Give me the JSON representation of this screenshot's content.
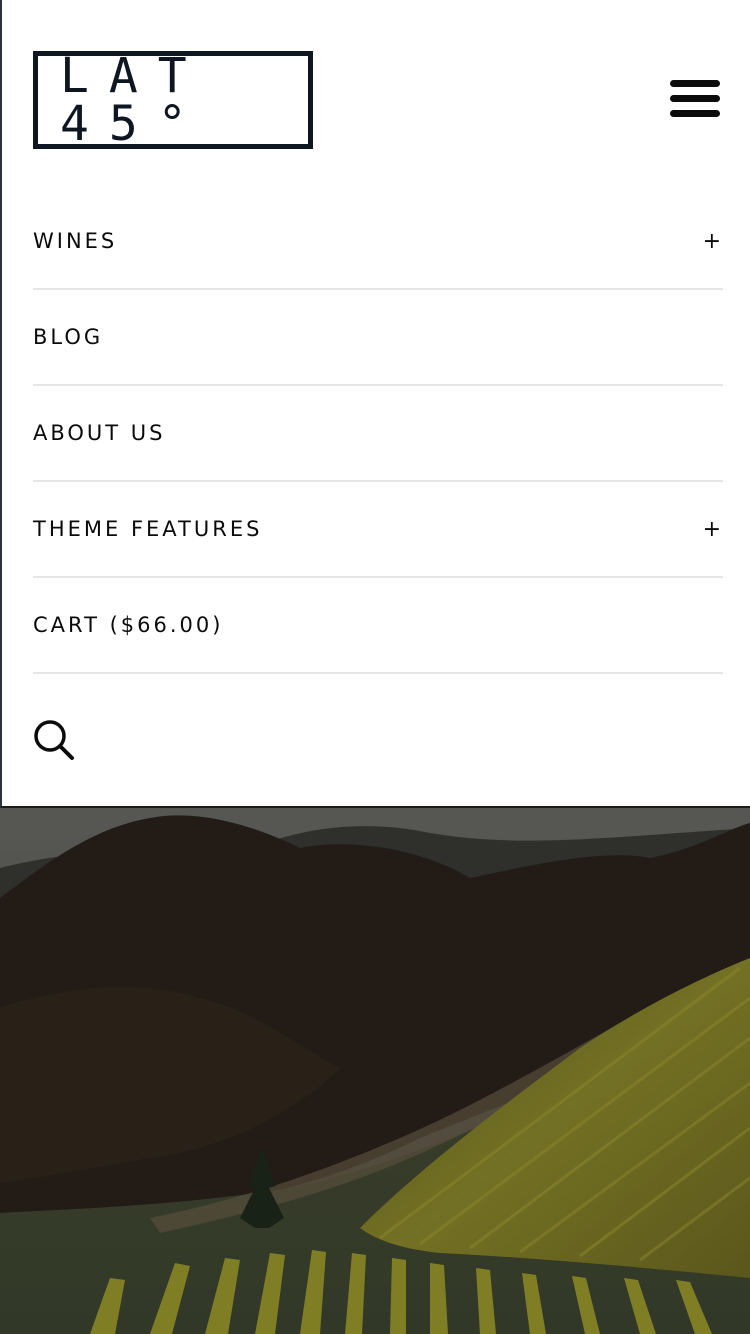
{
  "logo": {
    "text": "LAT 45°"
  },
  "nav": {
    "items": [
      {
        "label": "WINES",
        "expand": "+"
      },
      {
        "label": "BLOG",
        "expand": ""
      },
      {
        "label": "ABOUT US",
        "expand": ""
      },
      {
        "label": "THEME FEATURES",
        "expand": "+"
      },
      {
        "label": "CART ($66.00)",
        "expand": ""
      }
    ]
  },
  "icons": {
    "menu": "hamburger-icon",
    "search": "search-icon",
    "expand": "plus-icon"
  },
  "colors": {
    "logo_border": "#0e1621",
    "text": "#0b0b0b",
    "divider": "#e6e6e6",
    "hero_sky": "#5a5a58",
    "hero_trees": "#2b231c",
    "hero_vines": "#8c8a2a"
  }
}
